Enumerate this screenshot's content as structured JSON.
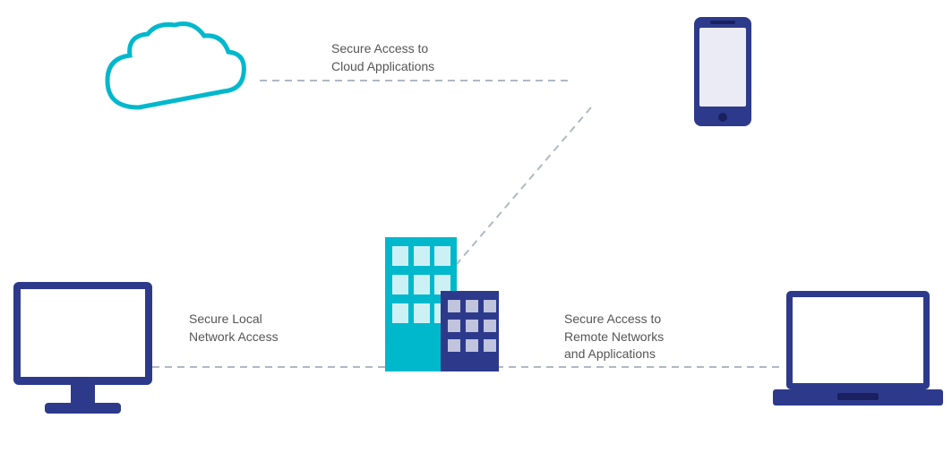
{
  "labels": {
    "cloud_access": "Secure Access to\nCloud Applications",
    "local_access": "Secure Local\nNetwork Access",
    "remote_access": "Secure Access to\nRemote Networks\nand Applications"
  },
  "colors": {
    "navy": "#2d3a8c",
    "teal": "#00b8cc",
    "light_teal": "#00c8d8",
    "gray_dash": "#b0b8c4",
    "white": "#ffffff"
  }
}
